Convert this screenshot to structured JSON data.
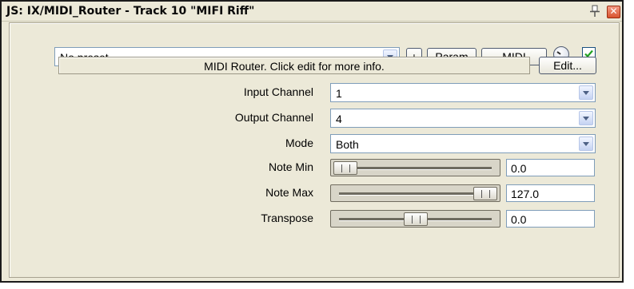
{
  "window": {
    "title": "JS: IX/MIDI_Router - Track 10 \"MIFI Riff\"",
    "close_glyph": "✕"
  },
  "toolbar": {
    "preset_value": "No preset",
    "plus_label": "+",
    "param_label": "Param",
    "midi_label": "MIDI",
    "enabled_checked": true
  },
  "info": {
    "text": "MIDI Router. Click edit for more info.",
    "edit_label": "Edit..."
  },
  "params": {
    "input_channel": {
      "label": "Input Channel",
      "value": "1"
    },
    "output_channel": {
      "label": "Output Channel",
      "value": "4"
    },
    "mode": {
      "label": "Mode",
      "value": "Both"
    },
    "note_min": {
      "label": "Note Min",
      "value": "0.0",
      "fraction": 0.0
    },
    "note_max": {
      "label": "Note Max",
      "value": "127.0",
      "fraction": 1.0
    },
    "transpose": {
      "label": "Transpose",
      "value": "0.0",
      "fraction": 0.5
    }
  },
  "colors": {
    "window_bg": "#ece9d8",
    "close_bg": "#d8532f",
    "check": "#21a121",
    "field_border": "#7f9db9"
  }
}
